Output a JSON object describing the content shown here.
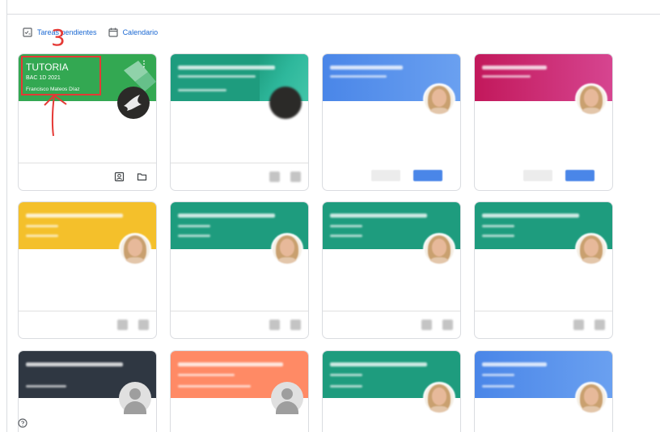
{
  "toolbar": {
    "pending_label": "Tareas pendientes",
    "calendar_label": "Calendario"
  },
  "annotation": {
    "number": "3"
  },
  "colors": {
    "link_blue": "#1967d2",
    "tutoria_green": "#33a852",
    "teal": "#1e9c7e",
    "blue": "#4a86e8",
    "magenta": "#c2185b",
    "yellow": "#f4c02b",
    "dark": "#2f3742",
    "orange": "#ff8a65",
    "annotation_red": "#e53935"
  },
  "cards": [
    {
      "title": "TUTORIA",
      "section": "BAC 1D 2021",
      "owner": "Francisco Mateos Díaz",
      "footer_icons": [
        "portfolio-icon",
        "folder-icon"
      ]
    }
  ]
}
